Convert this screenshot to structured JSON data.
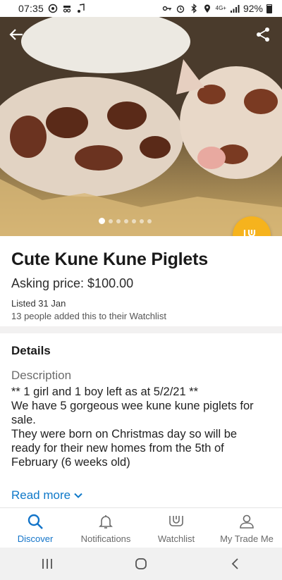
{
  "status_bar": {
    "time": "07:35",
    "network": "4G+",
    "battery": "92%"
  },
  "photo": {
    "alt_icons": {
      "back": "arrow-back-icon",
      "share": "share-icon"
    },
    "page_count": 7,
    "active_page": 0
  },
  "fab": {
    "icon": "watchlist-add-icon",
    "color": "#f6b31d"
  },
  "listing": {
    "title": "Cute Kune Kune Piglets",
    "price": "Asking price: $100.00",
    "listed": "Listed 31 Jan",
    "watchers": "13 people added this to their Watchlist"
  },
  "details": {
    "heading": "Details",
    "description_label": "Description",
    "lines": [
      "** 1 girl and 1 boy left as at 5/2/21 **",
      "We have 5 gorgeous wee kune kune piglets for",
      "sale.",
      "They were born on Christmas day so will be",
      "ready for their new homes from the 5th of",
      "February (6 weeks old)"
    ],
    "read_more": "Read more"
  },
  "tabs": [
    {
      "label": "Discover",
      "icon": "search-icon",
      "active": true
    },
    {
      "label": "Notifications",
      "icon": "bell-icon",
      "active": false
    },
    {
      "label": "Watchlist",
      "icon": "watchlist-icon",
      "active": false
    },
    {
      "label": "My Trade Me",
      "icon": "person-icon",
      "active": false
    }
  ],
  "colors": {
    "accent": "#1374c9",
    "link": "#0f79c9",
    "fab": "#f6b31d"
  }
}
